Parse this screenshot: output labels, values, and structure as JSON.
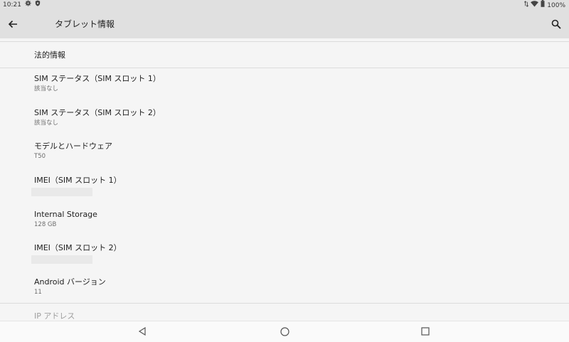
{
  "status": {
    "time": "10:21",
    "battery": "100%",
    "icons": [
      "gear-icon",
      "shield-icon",
      "data-arrows-icon",
      "wifi-icon",
      "battery-icon"
    ]
  },
  "app_bar": {
    "title": "タブレット情報",
    "icons": [
      "back-arrow-icon",
      "search-icon"
    ]
  },
  "section_header": "法的情報",
  "items": [
    {
      "title": "SIM ステータス（SIM スロット 1）",
      "summary": "該当なし"
    },
    {
      "title": "SIM ステータス（SIM スロット 2）",
      "summary": "該当なし"
    },
    {
      "title": "モデルとハードウェア",
      "summary": "T50"
    },
    {
      "title": "IMEI（SIM スロット 1）",
      "summary": ""
    },
    {
      "title": "Internal Storage",
      "summary": "128 GB"
    },
    {
      "title": "IMEI（SIM スロット 2）",
      "summary": ""
    },
    {
      "title": "Android バージョン",
      "summary": "11"
    }
  ],
  "ip_label": "IP アドレス",
  "nav": {
    "icons": [
      "nav-back-icon",
      "nav-home-icon",
      "nav-recents-icon"
    ]
  }
}
